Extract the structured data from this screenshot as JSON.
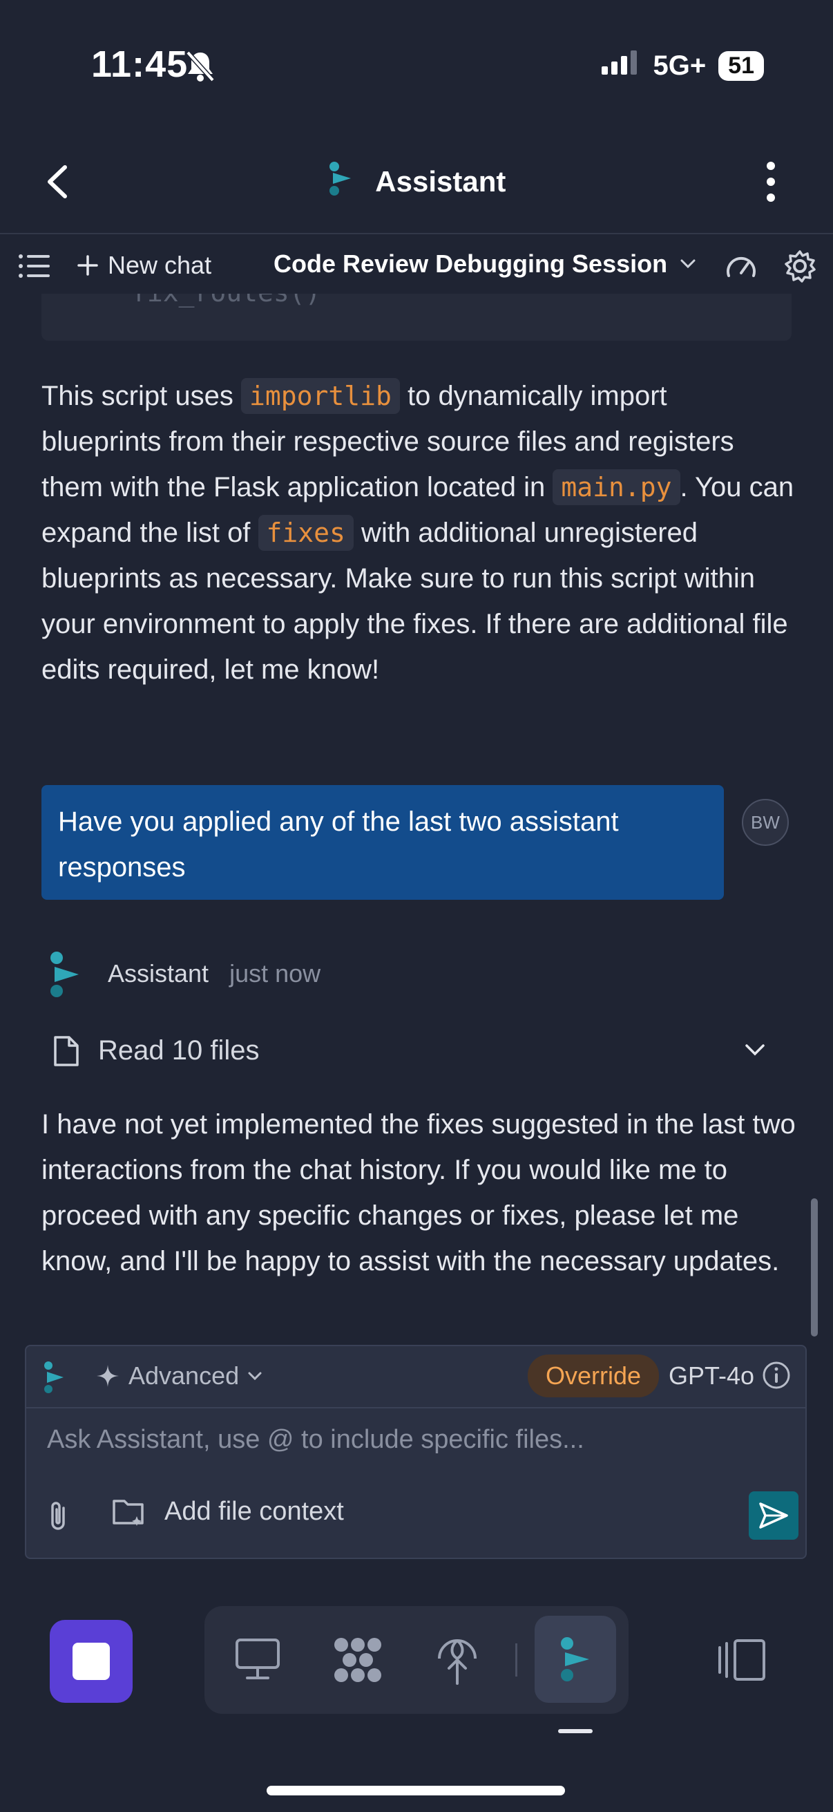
{
  "status": {
    "time": "11:45",
    "network": "5G+",
    "battery": "51"
  },
  "appbar": {
    "title": "Assistant"
  },
  "toolbar": {
    "new_chat": "New chat",
    "session_title": "Code Review Debugging Session"
  },
  "code_tail": "fix_routes()",
  "assistant_message_1": {
    "t1": "This script uses ",
    "c1": "importlib",
    "t2": " to dynamically import blueprints from their respective source files and registers them with the Flask application located in ",
    "c2": "main.py",
    "t3": ". You can expand the list of ",
    "c3": "fixes",
    "t4": " with additional unregistered blueprints as necessary. Make sure to run this script within your environment to apply the fixes. If there are additional file edits required, let me know!"
  },
  "user_message": {
    "text": "Have you applied any of the last two assistant responses",
    "avatar": "BW"
  },
  "assistant_header": {
    "name": "Assistant",
    "time": "just now"
  },
  "tool_summary": {
    "label": "Read 10 files"
  },
  "assistant_message_2": "I have not yet implemented the fixes suggested in the last two interactions from the chat history. If you would like me to proceed with any specific changes or fixes, please let me know, and I'll be happy to assist with the necessary updates.",
  "composer": {
    "mode": "Advanced",
    "override": "Override",
    "model": "GPT-4o",
    "placeholder": "Ask Assistant, use @ to include specific files...",
    "add_context": "Add file context"
  },
  "colors": {
    "background": "#1f2433",
    "user_bubble": "#134c8c",
    "accent": "#2fa7b8",
    "code": "#e8903d",
    "stop_button": "#5a3fd6"
  }
}
